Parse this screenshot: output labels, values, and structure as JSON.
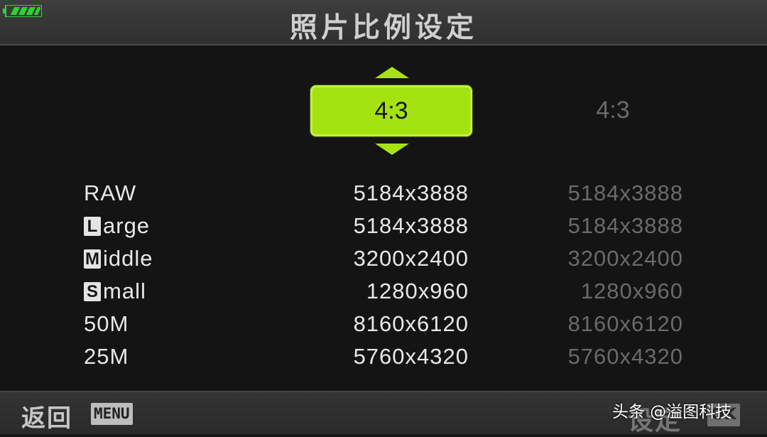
{
  "header": {
    "title": "照片比例设定"
  },
  "status": {
    "battery_level": "full",
    "battery_color": "#2cd32c"
  },
  "selector": {
    "current_ratio": "4:3",
    "alt_ratio": "4:3",
    "accent_color": "#a4e212"
  },
  "sizes": [
    {
      "prefix": "",
      "label": "RAW",
      "value": "5184x3888",
      "value_alt": "5184x3888"
    },
    {
      "prefix": "L",
      "label": "arge",
      "value": "5184x3888",
      "value_alt": "5184x3888"
    },
    {
      "prefix": "M",
      "label": "iddle",
      "value": "3200x2400",
      "value_alt": "3200x2400"
    },
    {
      "prefix": "S",
      "label": "mall",
      "value": "1280x960",
      "value_alt": "1280x960"
    },
    {
      "prefix": "",
      "label": "50M",
      "value": "8160x6120",
      "value_alt": "8160x6120"
    },
    {
      "prefix": "",
      "label": "25M",
      "value": "5760x4320",
      "value_alt": "5760x4320"
    }
  ],
  "footer": {
    "back_label": "返回",
    "menu_button": "MENU",
    "set_label": "设定",
    "ok_button": "OK",
    "watermark": "头条 @溢图科技"
  }
}
